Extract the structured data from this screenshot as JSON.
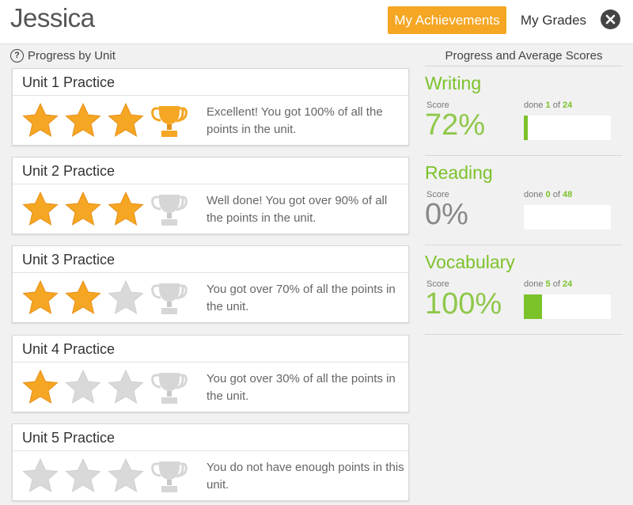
{
  "header": {
    "user_name": "Jessica",
    "tabs": [
      {
        "label": "My Achievements",
        "active": true
      },
      {
        "label": "My Grades",
        "active": false
      }
    ]
  },
  "left_panel": {
    "title": "Progress by Unit",
    "help_glyph": "?",
    "units": [
      {
        "title": "Unit 1 Practice",
        "stars": 3,
        "trophy": true,
        "message": "Excellent! You got 100% of all the points in the unit."
      },
      {
        "title": "Unit 2 Practice",
        "stars": 3,
        "trophy": false,
        "message": "Well done! You got over 90% of all the points in the unit."
      },
      {
        "title": "Unit 3 Practice",
        "stars": 2,
        "trophy": false,
        "message": "You got over 70% of all the points in the unit."
      },
      {
        "title": "Unit 4 Practice",
        "stars": 1,
        "trophy": false,
        "message": "You got over 30% of all the points in the unit."
      },
      {
        "title": "Unit 5 Practice",
        "stars": 0,
        "trophy": false,
        "message": "You do not have enough points in this unit."
      }
    ]
  },
  "right_panel": {
    "title": "Progress and Average Scores",
    "score_label": "Score",
    "done_label": "done",
    "of_label": "of",
    "skills": [
      {
        "name": "Writing",
        "score": "72%",
        "done": 1,
        "total": 24
      },
      {
        "name": "Reading",
        "score": "0%",
        "done": 0,
        "total": 48
      },
      {
        "name": "Vocabulary",
        "score": "100%",
        "done": 5,
        "total": 24
      }
    ]
  },
  "colors": {
    "accent_orange": "#f5a623",
    "star_gold": "#f5a623",
    "star_gray": "#d9d9d9",
    "accent_green": "#7cc22b"
  }
}
